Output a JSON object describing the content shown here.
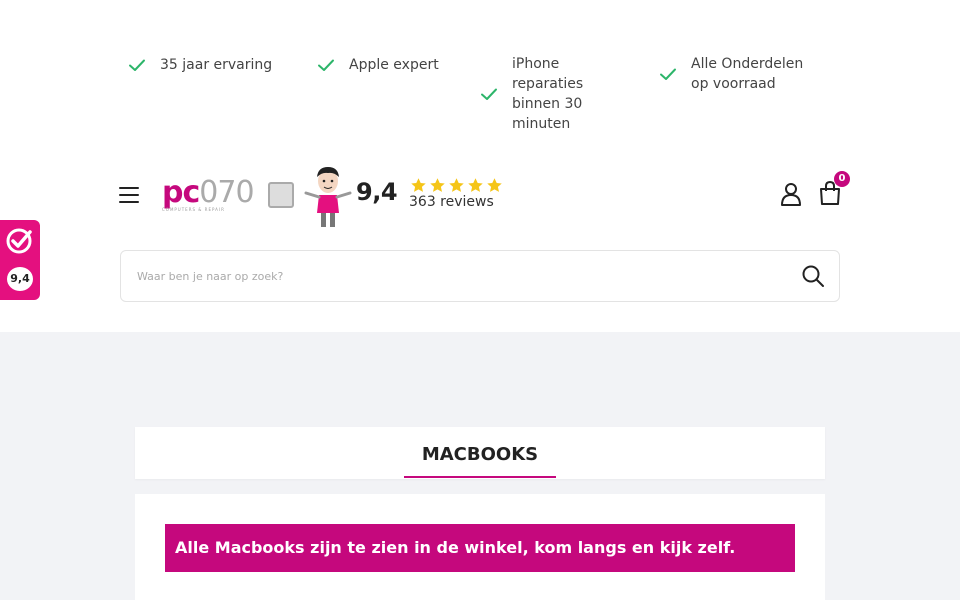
{
  "usps": [
    {
      "text": "35 jaar ervaring",
      "icon": "check-icon"
    },
    {
      "text": "Apple expert",
      "icon": "check-icon"
    },
    {
      "text": "iPhone reparaties binnen 30 minuten",
      "icon": "check-icon"
    },
    {
      "text": "Alle Onderdelen op voorraad",
      "icon": "check-icon"
    }
  ],
  "header": {
    "logo_text_a": "pc",
    "logo_text_b": "070",
    "logo_subtext": "COMPUTERS & REPAIR",
    "rating": "9,4",
    "stars": 5,
    "reviews": "363 reviews",
    "cart_count": "0",
    "icons": {
      "menu": "hamburger-menu-icon",
      "account": "user-icon",
      "cart": "shopping-bag-icon",
      "search": "search-icon"
    }
  },
  "search": {
    "placeholder": "Waar ben je naar op zoek?",
    "value": ""
  },
  "side_badge": {
    "score": "9,4",
    "icon": "kiyoh-check-icon"
  },
  "main": {
    "tab_label": "MACBOOKS",
    "banner_text": "Alle Macbooks zijn te zien in de winkel, kom langs en kijk zelf."
  },
  "colors": {
    "brand": "#c5087d",
    "check": "#2db56a",
    "star": "#f5c518",
    "side_tab": "#e4107f",
    "background": "#f2f3f6"
  }
}
